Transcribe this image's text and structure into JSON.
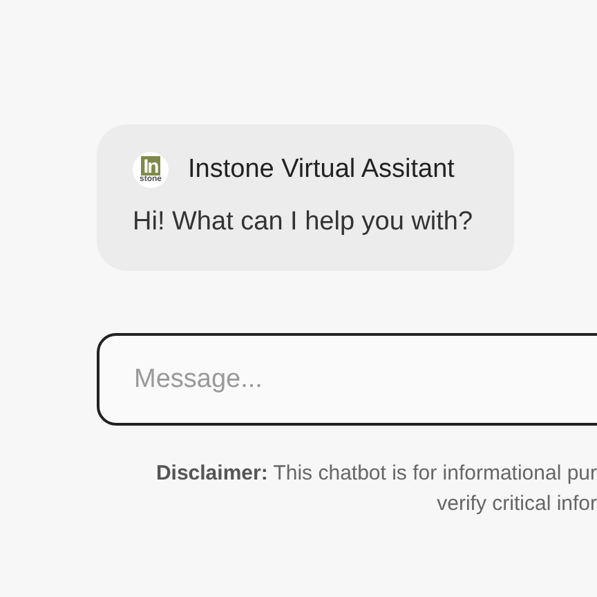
{
  "message": {
    "logo": {
      "mark": "In",
      "word": "stone"
    },
    "sender": "Instone Virtual Assitant",
    "text": "Hi! What can I help you with?"
  },
  "composer": {
    "placeholder": "Message..."
  },
  "disclaimer": "**Disclaimer:** This chatbot is for informational pur\nverify critical infor"
}
